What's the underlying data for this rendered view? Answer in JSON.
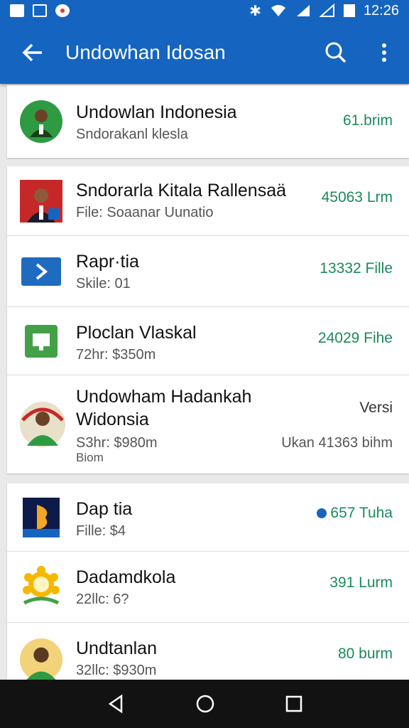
{
  "status": {
    "time": "12:26"
  },
  "appbar": {
    "title": "Undowhan Idosan"
  },
  "items": [
    {
      "title": "Undowlan Indonesia",
      "sub": "Sndorakanl klesla",
      "meta": "61.brim"
    },
    {
      "title": "Sndorarla Kitala Rallensaä",
      "sub": "File: Soaanar Uunatio",
      "meta": "45063 Lrm"
    },
    {
      "title": "Rapr·tia",
      "sub": "Skile: 01",
      "meta": "13332 Fille"
    },
    {
      "title": "Ploclan Vlaskal",
      "sub": "72hr: $350m",
      "meta": "24029 Fihe"
    },
    {
      "title": "Undowham Hadankah",
      "title2": "Widonsia",
      "sub": "S3hr: $980m",
      "sub2": "Biom",
      "meta": "Versi",
      "meta2": "Ukan 41363 bihm"
    },
    {
      "title": "Dap tia",
      "sub": "Fille: $4",
      "meta": "657 Tuha"
    },
    {
      "title": "Dadamdkola",
      "sub": "22llc: 6?",
      "meta": "391 Lurm"
    },
    {
      "title": "Undtanlan",
      "sub": "32llc: $930m",
      "meta": "80 burm"
    }
  ],
  "colors": {
    "primary": "#1565c0",
    "accent": "#1b8a5a"
  }
}
